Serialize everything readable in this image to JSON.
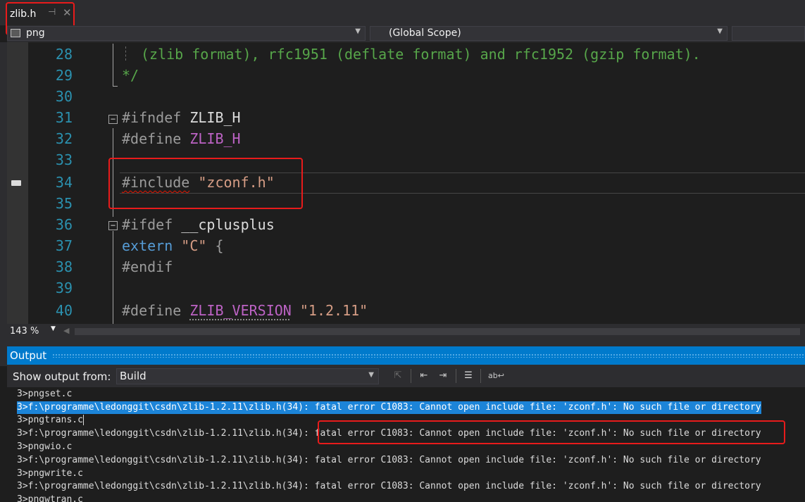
{
  "tab": {
    "title": "zlib.h",
    "pin_icon": "pin-icon",
    "close_icon": "close-icon"
  },
  "navbar": {
    "project": "png",
    "scope": "(Global Scope)"
  },
  "editor": {
    "lines": [
      {
        "num": "28",
        "text": "(zlib format), rfc1951 (deflate format) and rfc1952 (gzip format)."
      },
      {
        "num": "29",
        "text": "*/"
      },
      {
        "num": "30"
      },
      {
        "num": "31",
        "pp": "#ifndef",
        "name": "ZLIB_H"
      },
      {
        "num": "32",
        "pp": "#define",
        "name": "ZLIB_H"
      },
      {
        "num": "33"
      },
      {
        "num": "34",
        "pp": "#include",
        "str": "\"zconf.h\""
      },
      {
        "num": "35"
      },
      {
        "num": "36",
        "pp": "#ifdef",
        "name": "__cplusplus"
      },
      {
        "num": "37",
        "kw": "extern",
        "str": "\"C\"",
        "brace": "{"
      },
      {
        "num": "38",
        "pp": "#endif"
      },
      {
        "num": "39"
      },
      {
        "num": "40",
        "pp": "#define",
        "name": "ZLIB_VERSION",
        "str": "\"1.2.11\""
      }
    ]
  },
  "zoom": {
    "value": "143 %"
  },
  "output": {
    "title": "Output",
    "show_label": "Show output from:",
    "source": "Build",
    "lines": [
      "3>pngset.c",
      "3>f:\\programme\\ledonggit\\csdn\\zlib-1.2.11\\zlib.h(34): fatal error C1083: Cannot open include file: 'zconf.h': No such file or directory",
      "3>pngtrans.c",
      "3>f:\\programme\\ledonggit\\csdn\\zlib-1.2.11\\zlib.h(34): fatal error C1083: Cannot open include file: 'zconf.h': No such file or directory",
      "3>pngwio.c",
      "3>f:\\programme\\ledonggit\\csdn\\zlib-1.2.11\\zlib.h(34): fatal error C1083: Cannot open include file: 'zconf.h': No such file or directory",
      "3>pngwrite.c",
      "3>f:\\programme\\ledonggit\\csdn\\zlib-1.2.11\\zlib.h(34): fatal error C1083: Cannot open include file: 'zconf.h': No such file or directory",
      "3>pngwtran.c"
    ]
  },
  "colors": {
    "accent": "#007acc",
    "highlight_box": "#e81b1b",
    "selection": "#1c84d8"
  }
}
